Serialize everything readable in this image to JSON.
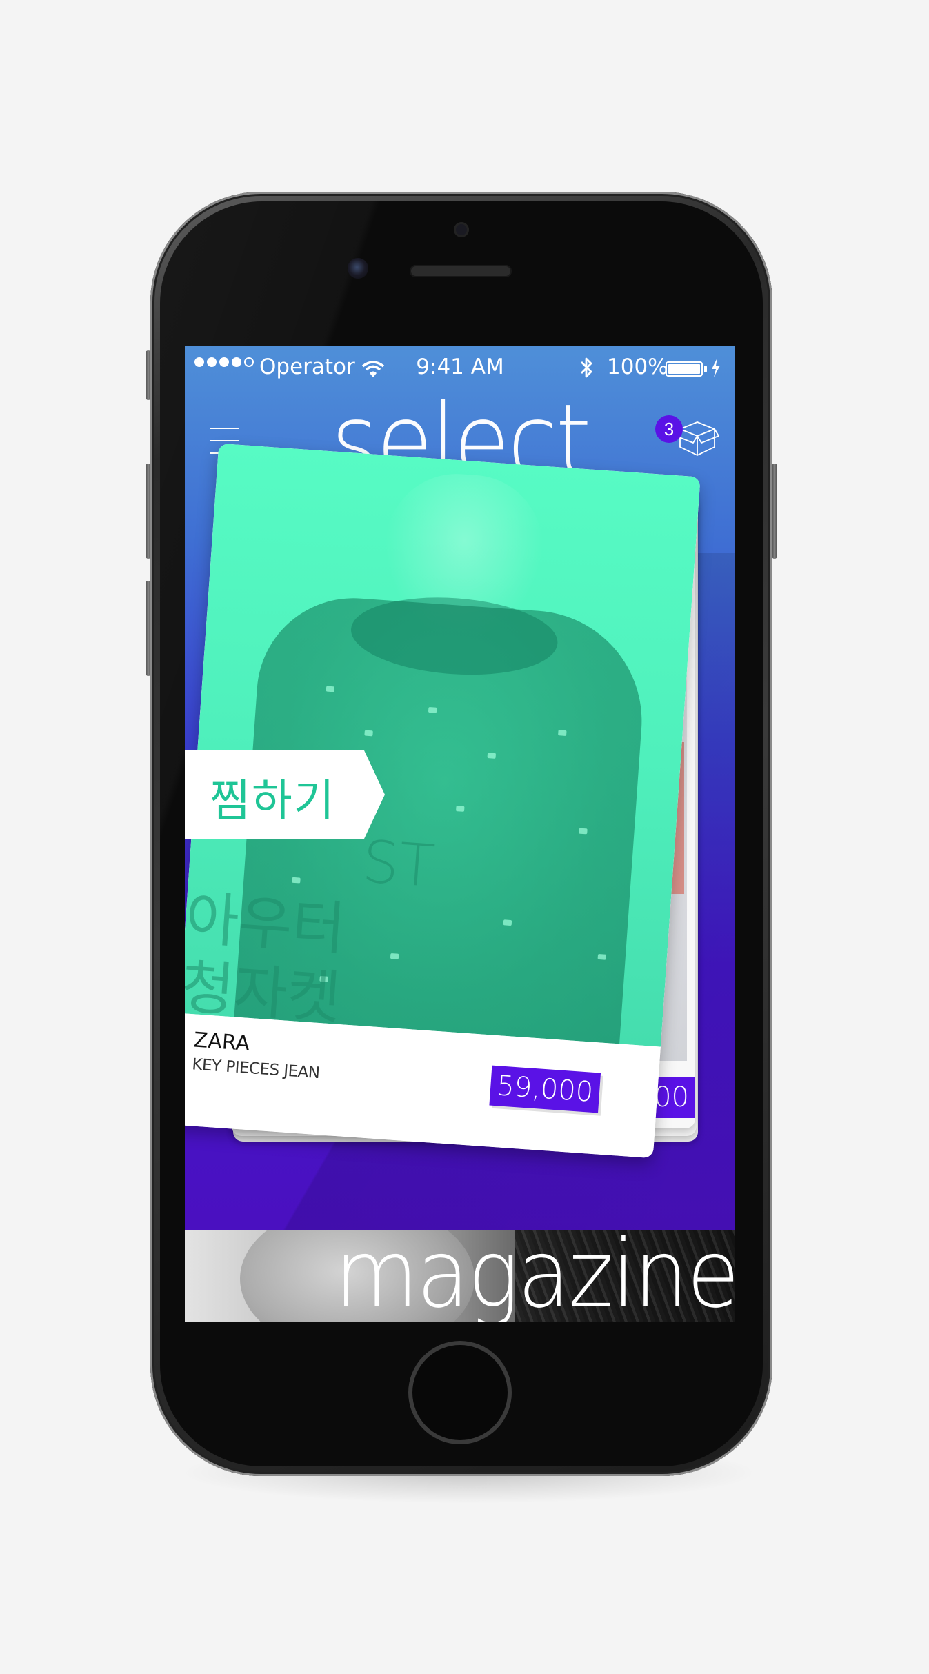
{
  "status_bar": {
    "carrier": "Operator",
    "time": "9:41 AM",
    "battery": "100%",
    "signal_bars": 4
  },
  "header": {
    "title": "select",
    "cart_badge": "3",
    "menu_icon": "hamburger-icon",
    "cart_icon": "box-icon"
  },
  "card": {
    "brand": "ZARA",
    "name": "KEY PIECES JEAN",
    "price": "59,000",
    "wishlist_label": "찜하기",
    "overlay_text": [
      "ST",
      "아우터",
      "청자켓"
    ]
  },
  "back_card": {
    "price_partial": "00"
  },
  "magazine": {
    "label": "magazine"
  },
  "colors": {
    "accent_purple": "#5a12e6",
    "mint": "#57fbc4",
    "mint_text": "#1fc596",
    "gradient_top": "#4f8fd8",
    "gradient_bottom": "#4a10c0"
  }
}
